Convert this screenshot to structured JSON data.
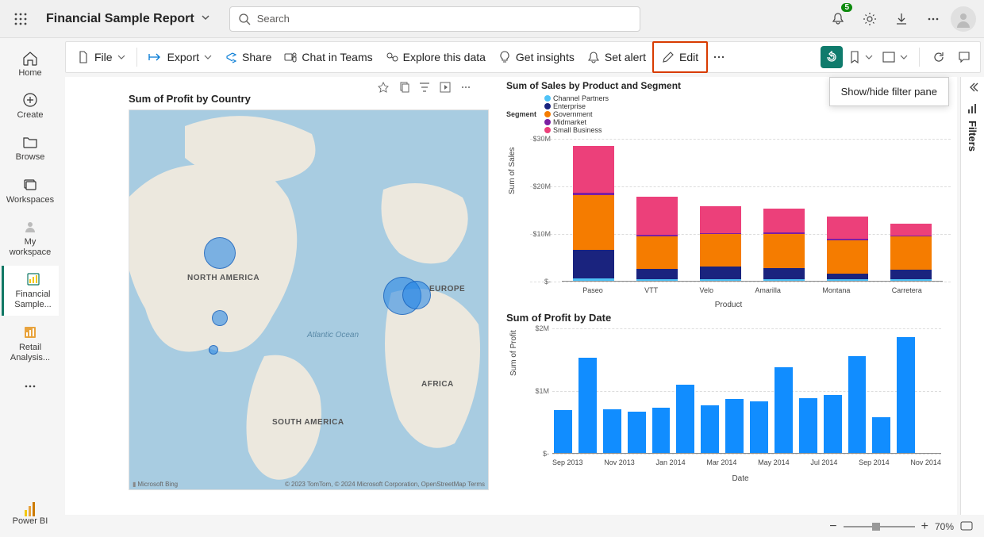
{
  "header": {
    "workspace_title": "Financial Sample Report",
    "search_placeholder": "Search",
    "notifications_count": "5"
  },
  "leftnav": {
    "items": [
      {
        "label": "Home"
      },
      {
        "label": "Create"
      },
      {
        "label": "Browse"
      },
      {
        "label": "Workspaces"
      },
      {
        "label": "My workspace"
      },
      {
        "label": "Financial Sample..."
      },
      {
        "label": "Retail Analysis..."
      }
    ],
    "footer": "Power BI"
  },
  "actionbar": {
    "file": "File",
    "export": "Export",
    "share": "Share",
    "teams": "Chat in Teams",
    "explore": "Explore this data",
    "insights": "Get insights",
    "alert": "Set alert",
    "edit": "Edit"
  },
  "tooltip": "Show/hide filter pane",
  "map": {
    "title": "Sum of Profit by Country",
    "continents": {
      "na": "NORTH AMERICA",
      "sa": "SOUTH AMERICA",
      "eu": "EUROPE",
      "af": "AFRICA"
    },
    "ocean": "Atlantic Ocean",
    "attrib_left": "Microsoft Bing",
    "attrib_right": "© 2023 TomTom, © 2024 Microsoft Corporation, OpenStreetMap  Terms"
  },
  "filters_label": "Filters",
  "zoom_pct": "70%",
  "chart_data": [
    {
      "type": "bar",
      "title": "Sum of Sales by Product and Segment",
      "legend_title": "Segment",
      "xlabel": "Product",
      "ylabel": "Sum of Sales",
      "ylim": [
        0,
        35
      ],
      "yticks": [
        "$-",
        "$10M",
        "$20M",
        "$30M"
      ],
      "categories": [
        "Paseo",
        "VTT",
        "Velo",
        "Amarilla",
        "Montana",
        "Carretera"
      ],
      "series": [
        {
          "name": "Channel Partners",
          "color": "#4fc3f7",
          "values": [
            0.5,
            0.4,
            0.4,
            0.3,
            0.3,
            0.3
          ]
        },
        {
          "name": "Enterprise",
          "color": "#1a237e",
          "values": [
            7.0,
            2.5,
            3.2,
            2.8,
            1.5,
            2.5
          ]
        },
        {
          "name": "Government",
          "color": "#f57c00",
          "values": [
            13.5,
            8.0,
            7.8,
            8.4,
            8.2,
            8.0
          ]
        },
        {
          "name": "Midmarket",
          "color": "#7b1fa2",
          "values": [
            0.6,
            0.4,
            0.3,
            0.3,
            0.3,
            0.3
          ]
        },
        {
          "name": "Small Business",
          "color": "#ec407a",
          "values": [
            11.5,
            9.4,
            6.6,
            6.0,
            5.5,
            3.0
          ]
        }
      ]
    },
    {
      "type": "bar",
      "title": "Sum of Profit by Date",
      "xlabel": "Date",
      "ylabel": "Sum of Profit",
      "ylim": [
        0,
        2.2
      ],
      "yticks": [
        "$-",
        "$1M",
        "$2M"
      ],
      "categories": [
        "Sep 2013",
        "Oct 2013",
        "Nov 2013",
        "Dec 2013",
        "Jan 2014",
        "Feb 2014",
        "Mar 2014",
        "Apr 2014",
        "May 2014",
        "Jun 2014",
        "Jul 2014",
        "Aug 2014",
        "Sep 2014",
        "Oct 2014",
        "Nov 2014",
        "Dec 2014"
      ],
      "x_tick_labels": [
        "Sep 2013",
        "Nov 2013",
        "Jan 2014",
        "Mar 2014",
        "May 2014",
        "Jul 2014",
        "Sep 2014",
        "Nov 2014"
      ],
      "values": [
        0.75,
        1.67,
        0.77,
        0.73,
        0.8,
        1.2,
        0.84,
        0.95,
        0.9,
        1.5,
        0.96,
        1.02,
        1.7,
        0.62,
        2.03,
        0
      ],
      "color": "#118dff"
    }
  ]
}
